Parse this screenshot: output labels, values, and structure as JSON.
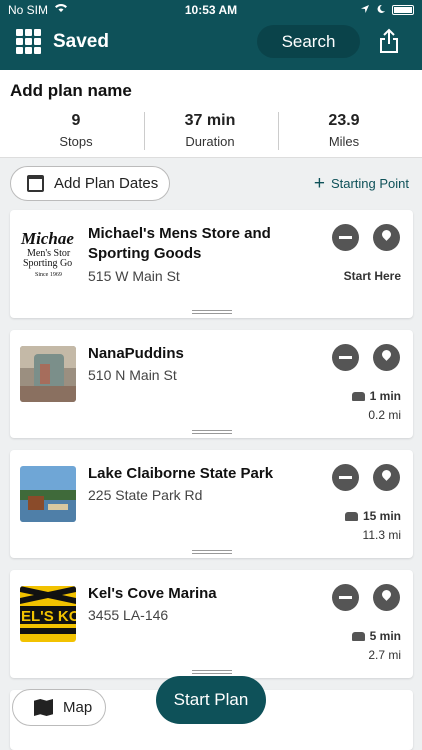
{
  "status_bar": {
    "carrier": "No SIM",
    "time": "10:53 AM"
  },
  "header": {
    "title": "Saved",
    "search_label": "Search"
  },
  "summary": {
    "plan_name": "Add plan name",
    "stats": [
      {
        "value": "9",
        "label": "Stops"
      },
      {
        "value": "37 min",
        "label": "Duration"
      },
      {
        "value": "23.9",
        "label": "Miles"
      }
    ]
  },
  "controls": {
    "add_dates_label": "Add Plan Dates",
    "starting_point_label": "Starting Point"
  },
  "stops": [
    {
      "name": "Michael's Mens Store and Sporting Goods",
      "address": "515 W Main St",
      "start_here": "Start Here"
    },
    {
      "name": "NanaPuddins",
      "address": "510 N Main St",
      "drive_time": "1 min",
      "drive_distance": "0.2 mi"
    },
    {
      "name": "Lake Claiborne State Park",
      "address": "225 State Park Rd",
      "drive_time": "15 min",
      "drive_distance": "11.3 mi"
    },
    {
      "name": "Kel's Cove Marina",
      "address": "3455 LA-146",
      "drive_time": "5 min",
      "drive_distance": "2.7 mi"
    }
  ],
  "bottom": {
    "map_label": "Map",
    "start_plan_label": "Start Plan"
  }
}
